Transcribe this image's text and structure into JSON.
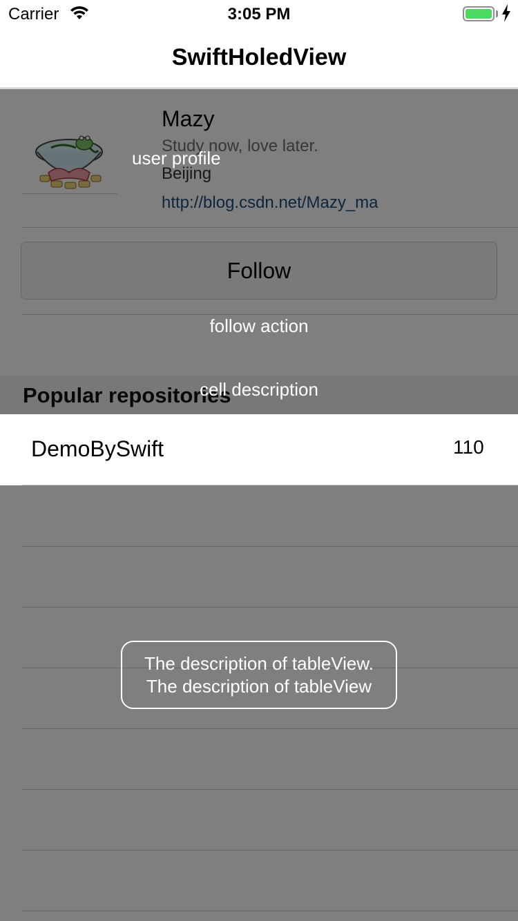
{
  "status_bar": {
    "carrier": "Carrier",
    "time": "3:05 PM",
    "wifi_icon": "wifi-icon",
    "battery_icon": "battery-icon",
    "charging_icon": "charging-bolt-icon",
    "battery_color": "#4cd964",
    "battery_level": 1.0
  },
  "nav": {
    "title": "SwiftHoledView"
  },
  "profile": {
    "avatar_icon": "avatar-image",
    "name": "Mazy",
    "bio": "Study now, love later.",
    "location": "Beijing",
    "link": "http://blog.csdn.net/Mazy_ma",
    "follow_label": "Follow"
  },
  "section": {
    "title": "Popular repositories"
  },
  "repositories": [
    {
      "name": "DemoBySwift",
      "count": "110"
    }
  ],
  "annotations": {
    "user_profile": "user profile",
    "follow_action": "follow action",
    "cell_description": "cell description",
    "tableview_line1": "The description of tableView.",
    "tableview_line2": "The description of tableView"
  },
  "colors": {
    "overlay": "rgba(0,0,0,0.5)",
    "link": "#1b4d7a",
    "annotation_text": "#ffffff"
  }
}
